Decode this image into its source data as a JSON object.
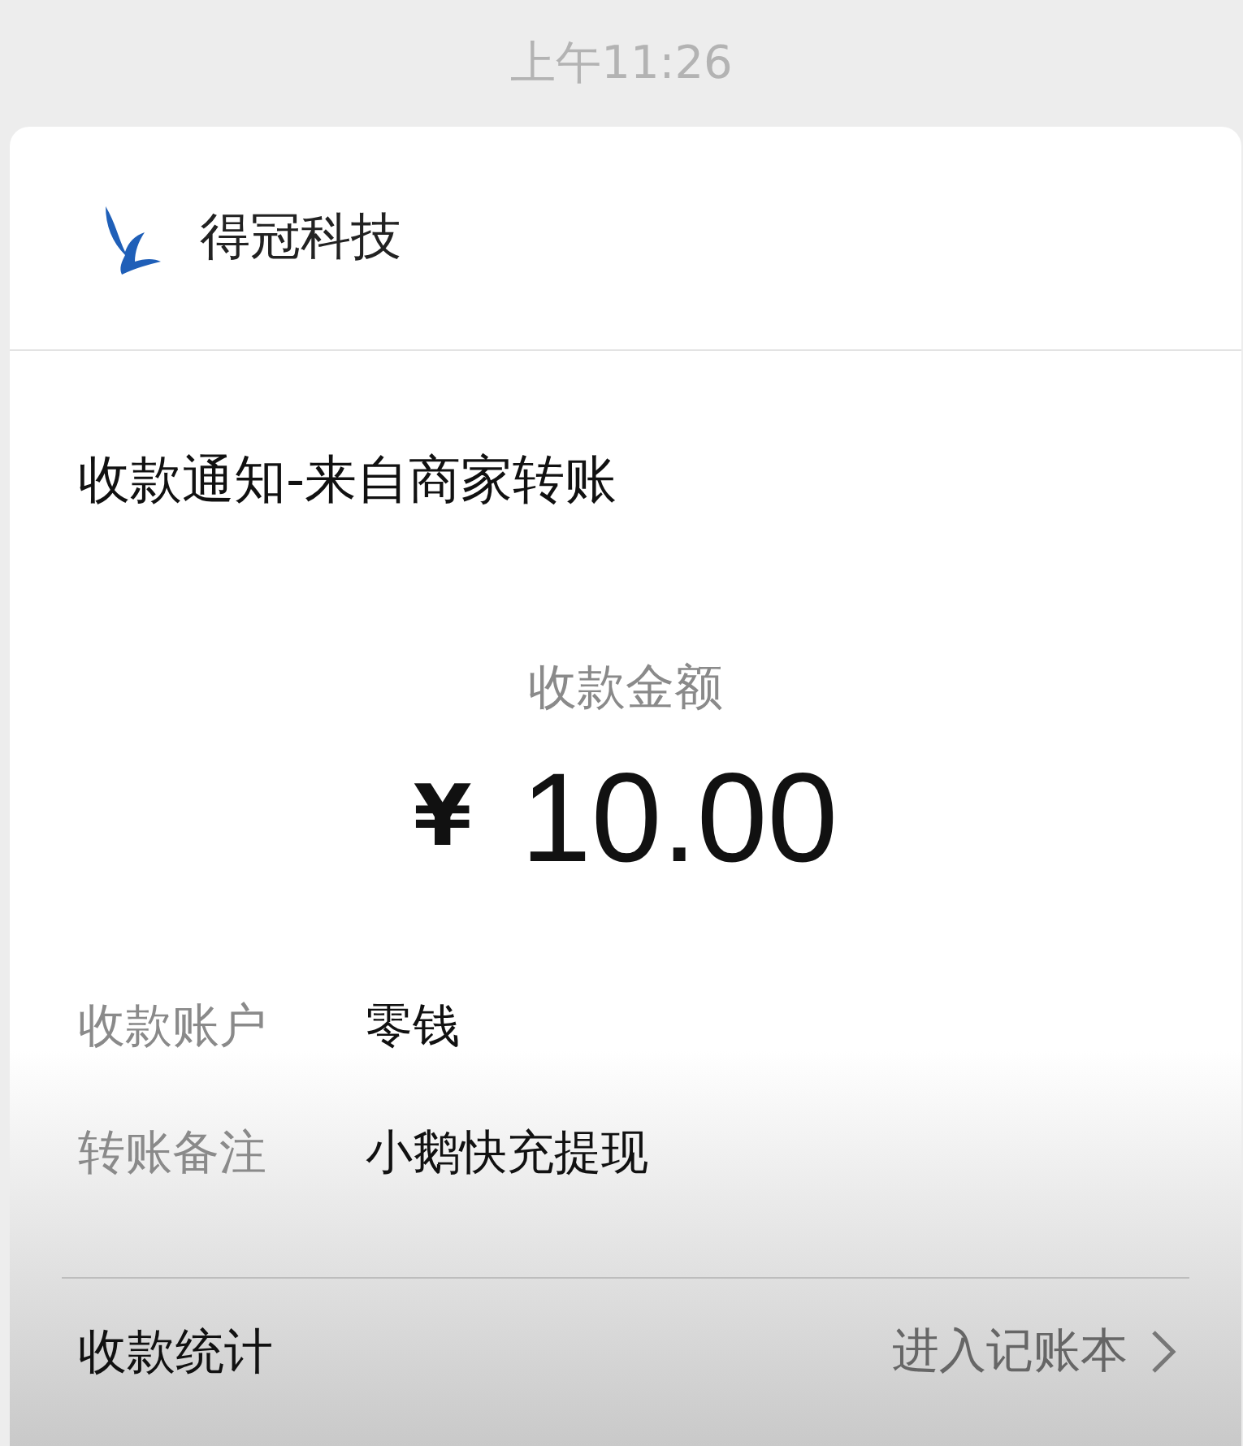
{
  "status_time": "上午11:26",
  "notification": {
    "app_name": "得冠科技",
    "title": "收款通知-来自商家转账",
    "amount_label": "收款金额",
    "currency": "¥",
    "amount": "10.00",
    "details": [
      {
        "label": "收款账户",
        "value": "零钱"
      },
      {
        "label": "转账备注",
        "value": "小鹅快充提现"
      }
    ],
    "footer": {
      "label": "收款统计",
      "link": "进入记账本"
    }
  }
}
